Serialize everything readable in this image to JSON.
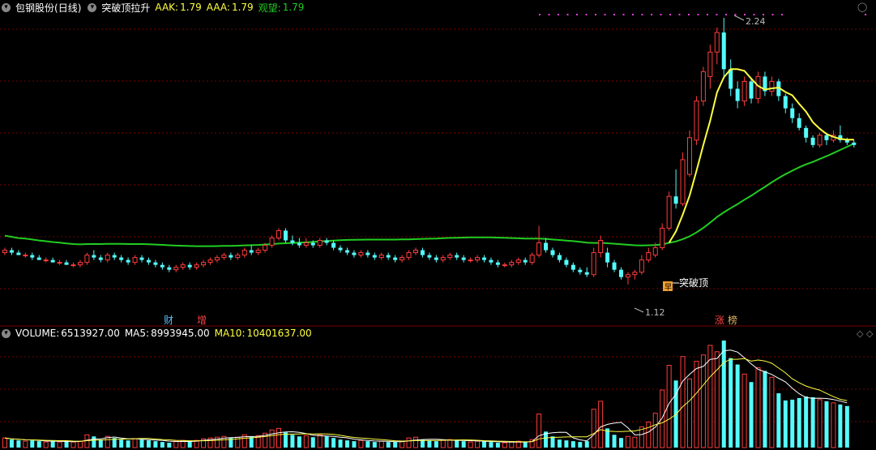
{
  "header": {
    "stock": "包钢股份",
    "period": "(日线)",
    "indicator": "突破顶拉升",
    "aak_label": "AAK:",
    "aak_value": "1.79",
    "aaa_label": "AAA:",
    "aaa_value": "1.79",
    "watch_label": "观望:",
    "watch_value": "1.79"
  },
  "volume_header": {
    "volume_label": "VOLUME:",
    "volume_value": "6513927.00",
    "ma5_label": "MA5:",
    "ma5_value": "8993945.00",
    "ma10_label": "MA10:",
    "ma10_value": "10401637.00"
  },
  "annotations": {
    "high_price": "2.24",
    "low_price": "1.12",
    "breakout": "突破顶",
    "marker_cai": "财",
    "marker_zeng": "增",
    "marker_zhang": "涨",
    "marker_bang": "榜"
  },
  "colors": {
    "up": "#ff3c3c",
    "down": "#54fcfc",
    "ma_green": "#22cc22",
    "ma_yellow": "#ffff40",
    "grid": "#7a0000",
    "background": "#000000"
  },
  "chart_data": {
    "type": "candlestick",
    "price_high_label": 2.24,
    "price_low_label": 1.12,
    "candles": [
      {
        "o": 1.38,
        "h": 1.4,
        "l": 1.37,
        "c": 1.39
      },
      {
        "o": 1.39,
        "h": 1.4,
        "l": 1.37,
        "c": 1.38
      },
      {
        "o": 1.38,
        "h": 1.39,
        "l": 1.37,
        "c": 1.37
      },
      {
        "o": 1.37,
        "h": 1.38,
        "l": 1.36,
        "c": 1.37
      },
      {
        "o": 1.37,
        "h": 1.38,
        "l": 1.35,
        "c": 1.36
      },
      {
        "o": 1.36,
        "h": 1.37,
        "l": 1.35,
        "c": 1.35
      },
      {
        "o": 1.35,
        "h": 1.36,
        "l": 1.34,
        "c": 1.35
      },
      {
        "o": 1.35,
        "h": 1.36,
        "l": 1.34,
        "c": 1.34
      },
      {
        "o": 1.34,
        "h": 1.35,
        "l": 1.33,
        "c": 1.34
      },
      {
        "o": 1.34,
        "h": 1.35,
        "l": 1.33,
        "c": 1.33
      },
      {
        "o": 1.33,
        "h": 1.34,
        "l": 1.32,
        "c": 1.33
      },
      {
        "o": 1.33,
        "h": 1.35,
        "l": 1.32,
        "c": 1.34
      },
      {
        "o": 1.34,
        "h": 1.38,
        "l": 1.33,
        "c": 1.37
      },
      {
        "o": 1.37,
        "h": 1.39,
        "l": 1.35,
        "c": 1.36
      },
      {
        "o": 1.36,
        "h": 1.37,
        "l": 1.34,
        "c": 1.35
      },
      {
        "o": 1.35,
        "h": 1.38,
        "l": 1.34,
        "c": 1.37
      },
      {
        "o": 1.37,
        "h": 1.38,
        "l": 1.35,
        "c": 1.36
      },
      {
        "o": 1.36,
        "h": 1.37,
        "l": 1.34,
        "c": 1.35
      },
      {
        "o": 1.35,
        "h": 1.36,
        "l": 1.33,
        "c": 1.34
      },
      {
        "o": 1.34,
        "h": 1.37,
        "l": 1.33,
        "c": 1.36
      },
      {
        "o": 1.36,
        "h": 1.37,
        "l": 1.34,
        "c": 1.35
      },
      {
        "o": 1.35,
        "h": 1.36,
        "l": 1.33,
        "c": 1.34
      },
      {
        "o": 1.34,
        "h": 1.35,
        "l": 1.32,
        "c": 1.33
      },
      {
        "o": 1.33,
        "h": 1.34,
        "l": 1.31,
        "c": 1.32
      },
      {
        "o": 1.32,
        "h": 1.33,
        "l": 1.3,
        "c": 1.31
      },
      {
        "o": 1.31,
        "h": 1.33,
        "l": 1.3,
        "c": 1.32
      },
      {
        "o": 1.32,
        "h": 1.34,
        "l": 1.31,
        "c": 1.33
      },
      {
        "o": 1.33,
        "h": 1.34,
        "l": 1.31,
        "c": 1.32
      },
      {
        "o": 1.32,
        "h": 1.34,
        "l": 1.31,
        "c": 1.33
      },
      {
        "o": 1.33,
        "h": 1.35,
        "l": 1.32,
        "c": 1.34
      },
      {
        "o": 1.34,
        "h": 1.36,
        "l": 1.33,
        "c": 1.35
      },
      {
        "o": 1.35,
        "h": 1.37,
        "l": 1.34,
        "c": 1.36
      },
      {
        "o": 1.36,
        "h": 1.38,
        "l": 1.35,
        "c": 1.37
      },
      {
        "o": 1.37,
        "h": 1.38,
        "l": 1.35,
        "c": 1.36
      },
      {
        "o": 1.36,
        "h": 1.38,
        "l": 1.35,
        "c": 1.37
      },
      {
        "o": 1.37,
        "h": 1.4,
        "l": 1.36,
        "c": 1.39
      },
      {
        "o": 1.39,
        "h": 1.41,
        "l": 1.37,
        "c": 1.38
      },
      {
        "o": 1.38,
        "h": 1.4,
        "l": 1.37,
        "c": 1.39
      },
      {
        "o": 1.39,
        "h": 1.42,
        "l": 1.38,
        "c": 1.41
      },
      {
        "o": 1.41,
        "h": 1.45,
        "l": 1.4,
        "c": 1.44
      },
      {
        "o": 1.44,
        "h": 1.48,
        "l": 1.43,
        "c": 1.47
      },
      {
        "o": 1.47,
        "h": 1.48,
        "l": 1.42,
        "c": 1.43
      },
      {
        "o": 1.43,
        "h": 1.45,
        "l": 1.41,
        "c": 1.42
      },
      {
        "o": 1.42,
        "h": 1.44,
        "l": 1.4,
        "c": 1.41
      },
      {
        "o": 1.41,
        "h": 1.44,
        "l": 1.4,
        "c": 1.42
      },
      {
        "o": 1.42,
        "h": 1.43,
        "l": 1.4,
        "c": 1.41
      },
      {
        "o": 1.41,
        "h": 1.44,
        "l": 1.4,
        "c": 1.43
      },
      {
        "o": 1.43,
        "h": 1.44,
        "l": 1.41,
        "c": 1.42
      },
      {
        "o": 1.42,
        "h": 1.43,
        "l": 1.39,
        "c": 1.4
      },
      {
        "o": 1.4,
        "h": 1.41,
        "l": 1.38,
        "c": 1.39
      },
      {
        "o": 1.39,
        "h": 1.4,
        "l": 1.37,
        "c": 1.38
      },
      {
        "o": 1.38,
        "h": 1.39,
        "l": 1.36,
        "c": 1.37
      },
      {
        "o": 1.37,
        "h": 1.39,
        "l": 1.36,
        "c": 1.38
      },
      {
        "o": 1.38,
        "h": 1.39,
        "l": 1.36,
        "c": 1.37
      },
      {
        "o": 1.37,
        "h": 1.38,
        "l": 1.35,
        "c": 1.36
      },
      {
        "o": 1.36,
        "h": 1.38,
        "l": 1.35,
        "c": 1.37
      },
      {
        "o": 1.37,
        "h": 1.38,
        "l": 1.35,
        "c": 1.36
      },
      {
        "o": 1.36,
        "h": 1.37,
        "l": 1.34,
        "c": 1.35
      },
      {
        "o": 1.35,
        "h": 1.37,
        "l": 1.34,
        "c": 1.36
      },
      {
        "o": 1.36,
        "h": 1.39,
        "l": 1.35,
        "c": 1.38
      },
      {
        "o": 1.38,
        "h": 1.4,
        "l": 1.37,
        "c": 1.39
      },
      {
        "o": 1.39,
        "h": 1.4,
        "l": 1.36,
        "c": 1.37
      },
      {
        "o": 1.37,
        "h": 1.38,
        "l": 1.35,
        "c": 1.36
      },
      {
        "o": 1.36,
        "h": 1.37,
        "l": 1.34,
        "c": 1.35
      },
      {
        "o": 1.35,
        "h": 1.37,
        "l": 1.34,
        "c": 1.36
      },
      {
        "o": 1.36,
        "h": 1.38,
        "l": 1.35,
        "c": 1.37
      },
      {
        "o": 1.37,
        "h": 1.38,
        "l": 1.35,
        "c": 1.36
      },
      {
        "o": 1.36,
        "h": 1.37,
        "l": 1.34,
        "c": 1.35
      },
      {
        "o": 1.35,
        "h": 1.36,
        "l": 1.34,
        "c": 1.35
      },
      {
        "o": 1.35,
        "h": 1.37,
        "l": 1.34,
        "c": 1.36
      },
      {
        "o": 1.36,
        "h": 1.37,
        "l": 1.34,
        "c": 1.35
      },
      {
        "o": 1.35,
        "h": 1.36,
        "l": 1.33,
        "c": 1.34
      },
      {
        "o": 1.34,
        "h": 1.35,
        "l": 1.32,
        "c": 1.33
      },
      {
        "o": 1.33,
        "h": 1.34,
        "l": 1.32,
        "c": 1.33
      },
      {
        "o": 1.33,
        "h": 1.35,
        "l": 1.32,
        "c": 1.34
      },
      {
        "o": 1.34,
        "h": 1.36,
        "l": 1.33,
        "c": 1.35
      },
      {
        "o": 1.35,
        "h": 1.36,
        "l": 1.33,
        "c": 1.34
      },
      {
        "o": 1.34,
        "h": 1.38,
        "l": 1.33,
        "c": 1.37
      },
      {
        "o": 1.37,
        "h": 1.49,
        "l": 1.36,
        "c": 1.42
      },
      {
        "o": 1.42,
        "h": 1.44,
        "l": 1.38,
        "c": 1.39
      },
      {
        "o": 1.39,
        "h": 1.4,
        "l": 1.36,
        "c": 1.37
      },
      {
        "o": 1.37,
        "h": 1.38,
        "l": 1.34,
        "c": 1.35
      },
      {
        "o": 1.35,
        "h": 1.36,
        "l": 1.32,
        "c": 1.33
      },
      {
        "o": 1.33,
        "h": 1.34,
        "l": 1.3,
        "c": 1.31
      },
      {
        "o": 1.31,
        "h": 1.32,
        "l": 1.29,
        "c": 1.3
      },
      {
        "o": 1.3,
        "h": 1.32,
        "l": 1.28,
        "c": 1.29
      },
      {
        "o": 1.29,
        "h": 1.4,
        "l": 1.28,
        "c": 1.38
      },
      {
        "o": 1.38,
        "h": 1.45,
        "l": 1.36,
        "c": 1.43
      },
      {
        "o": 1.38,
        "h": 1.4,
        "l": 1.32,
        "c": 1.34
      },
      {
        "o": 1.34,
        "h": 1.35,
        "l": 1.3,
        "c": 1.31
      },
      {
        "o": 1.31,
        "h": 1.32,
        "l": 1.27,
        "c": 1.28
      },
      {
        "o": 1.28,
        "h": 1.3,
        "l": 1.25,
        "c": 1.29
      },
      {
        "o": 1.29,
        "h": 1.31,
        "l": 1.27,
        "c": 1.3
      },
      {
        "o": 1.3,
        "h": 1.37,
        "l": 1.29,
        "c": 1.35
      },
      {
        "o": 1.35,
        "h": 1.4,
        "l": 1.34,
        "c": 1.38
      },
      {
        "o": 1.37,
        "h": 1.42,
        "l": 1.36,
        "c": 1.4
      },
      {
        "o": 1.4,
        "h": 1.5,
        "l": 1.39,
        "c": 1.48
      },
      {
        "o": 1.48,
        "h": 1.63,
        "l": 1.47,
        "c": 1.61
      },
      {
        "o": 1.61,
        "h": 1.72,
        "l": 1.56,
        "c": 1.58
      },
      {
        "o": 1.58,
        "h": 1.79,
        "l": 1.57,
        "c": 1.76
      },
      {
        "o": 1.7,
        "h": 1.88,
        "l": 1.69,
        "c": 1.85
      },
      {
        "o": 1.84,
        "h": 2.02,
        "l": 1.82,
        "c": 2.0
      },
      {
        "o": 2.0,
        "h": 2.14,
        "l": 1.98,
        "c": 2.12
      },
      {
        "o": 2.1,
        "h": 2.23,
        "l": 2.05,
        "c": 2.2
      },
      {
        "o": 2.2,
        "h": 2.3,
        "l": 2.15,
        "c": 2.28
      },
      {
        "o": 2.28,
        "h": 2.34,
        "l": 2.09,
        "c": 2.13
      },
      {
        "o": 2.13,
        "h": 2.17,
        "l": 2.02,
        "c": 2.05
      },
      {
        "o": 2.05,
        "h": 2.08,
        "l": 1.97,
        "c": 2.0
      },
      {
        "o": 2.0,
        "h": 2.1,
        "l": 1.98,
        "c": 2.08
      },
      {
        "o": 2.08,
        "h": 2.09,
        "l": 1.99,
        "c": 2.01
      },
      {
        "o": 2.01,
        "h": 2.12,
        "l": 1.99,
        "c": 2.1
      },
      {
        "o": 2.1,
        "h": 2.12,
        "l": 2.02,
        "c": 2.04
      },
      {
        "o": 2.04,
        "h": 2.1,
        "l": 2.02,
        "c": 2.08
      },
      {
        "o": 2.08,
        "h": 2.09,
        "l": 2.0,
        "c": 2.02
      },
      {
        "o": 2.02,
        "h": 2.03,
        "l": 1.95,
        "c": 1.97
      },
      {
        "o": 1.97,
        "h": 1.99,
        "l": 1.91,
        "c": 1.93
      },
      {
        "o": 1.93,
        "h": 1.95,
        "l": 1.88,
        "c": 1.89
      },
      {
        "o": 1.89,
        "h": 1.9,
        "l": 1.83,
        "c": 1.85
      },
      {
        "o": 1.85,
        "h": 1.86,
        "l": 1.81,
        "c": 1.82
      },
      {
        "o": 1.82,
        "h": 1.87,
        "l": 1.81,
        "c": 1.86
      },
      {
        "o": 1.86,
        "h": 1.87,
        "l": 1.82,
        "c": 1.84
      },
      {
        "o": 1.84,
        "h": 1.88,
        "l": 1.83,
        "c": 1.86
      },
      {
        "o": 1.86,
        "h": 1.9,
        "l": 1.83,
        "c": 1.84
      },
      {
        "o": 1.84,
        "h": 1.85,
        "l": 1.82,
        "c": 1.83
      },
      {
        "o": 1.83,
        "h": 1.84,
        "l": 1.81,
        "c": 1.82
      }
    ],
    "volumes": [
      1.2,
      1.0,
      0.9,
      0.8,
      0.9,
      0.8,
      0.7,
      0.8,
      0.7,
      0.8,
      0.7,
      0.8,
      1.6,
      1.4,
      1.0,
      1.4,
      1.2,
      1.0,
      0.9,
      1.1,
      1.0,
      0.9,
      0.8,
      0.7,
      0.6,
      0.8,
      0.9,
      0.8,
      0.9,
      1.1,
      1.2,
      1.3,
      1.4,
      1.2,
      1.3,
      1.6,
      1.4,
      1.5,
      1.8,
      2.2,
      2.4,
      1.9,
      1.6,
      1.4,
      1.5,
      1.3,
      1.6,
      1.4,
      1.2,
      1.0,
      0.9,
      0.8,
      0.9,
      0.8,
      0.7,
      0.8,
      0.7,
      0.7,
      0.8,
      1.2,
      1.3,
      1.0,
      0.9,
      0.8,
      0.9,
      1.0,
      0.9,
      0.8,
      0.7,
      0.8,
      0.8,
      0.7,
      0.6,
      0.6,
      0.7,
      0.8,
      0.7,
      1.0,
      4.2,
      2.0,
      1.4,
      1.0,
      0.9,
      0.8,
      0.7,
      0.8,
      4.8,
      5.8,
      2.4,
      1.6,
      1.2,
      1.4,
      1.3,
      2.6,
      3.2,
      4.3,
      7.2,
      10.3,
      8.4,
      11.4,
      8.6,
      10.8,
      11.6,
      12.8,
      12.0,
      13.4,
      11.2,
      10.4,
      9.2,
      8.2,
      10.0,
      9.6,
      8.8,
      6.8,
      5.9,
      6.0,
      6.2,
      6.4,
      6.3,
      6.0,
      5.8,
      5.6,
      5.4,
      5.2
    ]
  }
}
